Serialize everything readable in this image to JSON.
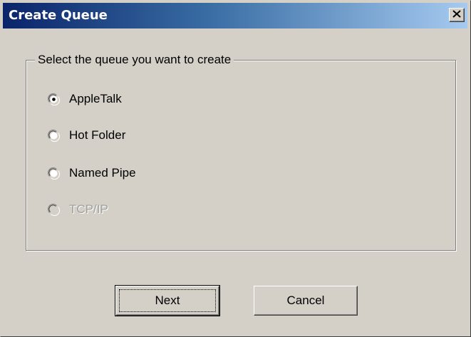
{
  "window": {
    "title": "Create Queue",
    "close_symbol": "×"
  },
  "group": {
    "legend": "Select the queue you want to create"
  },
  "options": [
    {
      "label": "AppleTalk",
      "checked": true,
      "enabled": true
    },
    {
      "label": "Hot Folder",
      "checked": false,
      "enabled": true
    },
    {
      "label": "Named Pipe",
      "checked": false,
      "enabled": true
    },
    {
      "label": "TCP/IP",
      "checked": false,
      "enabled": false
    }
  ],
  "buttons": {
    "next_label": "Next",
    "cancel_label": "Cancel"
  },
  "colors": {
    "title_start": "#0a246a",
    "title_end": "#a6caf0",
    "face": "#d4d0c8",
    "disabled_text": "#a0a0a0"
  },
  "icons": {
    "close": "close-icon",
    "radio": "radio-button-icon"
  }
}
